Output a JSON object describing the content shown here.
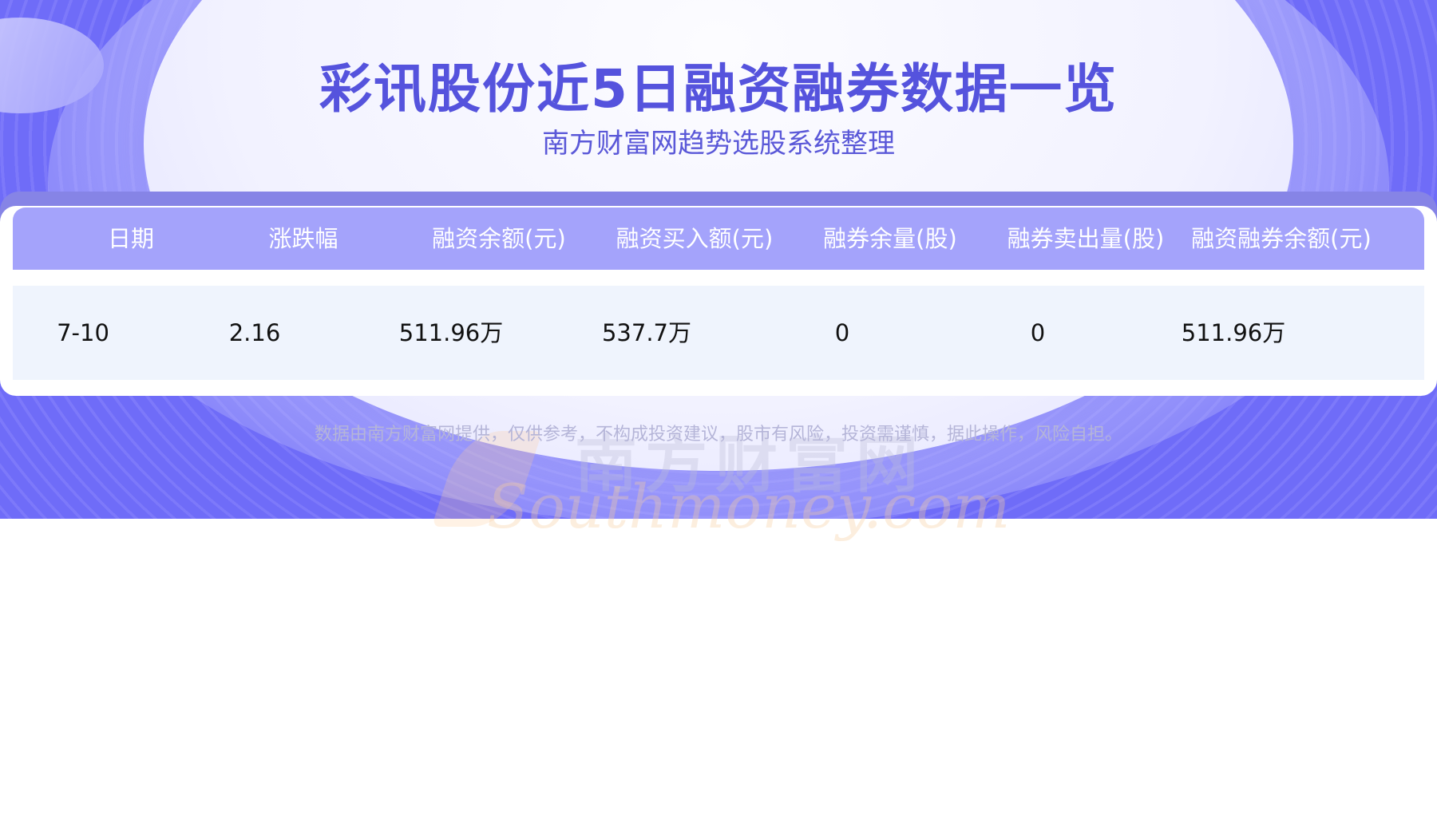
{
  "header": {
    "title": "彩讯股份近5日融资融券数据一览",
    "subtitle": "南方财富网趋势选股系统整理"
  },
  "table": {
    "columns": [
      "日期",
      "涨跌幅",
      "融资余额(元)",
      "融资买入额(元)",
      "融券余量(股)",
      "融券卖出量(股)",
      "融资融券余额(元)"
    ],
    "rows": [
      [
        "7-10",
        "2.16",
        "511.96万",
        "537.7万",
        "0",
        "0",
        "511.96万"
      ]
    ]
  },
  "footer": {
    "disclaimer": "数据由南方财富网提供，仅供参考，不构成投资建议，股市有风险，投资需谨慎，据此操作，风险自担。"
  },
  "watermark": {
    "cn": "南方财富网",
    "en": "Southmoney.com"
  },
  "colors": {
    "accent": "#5553dd",
    "header_bg": "#a4a3fb",
    "row_bg": "#eff4fd",
    "banner": "#6f6cf8"
  }
}
